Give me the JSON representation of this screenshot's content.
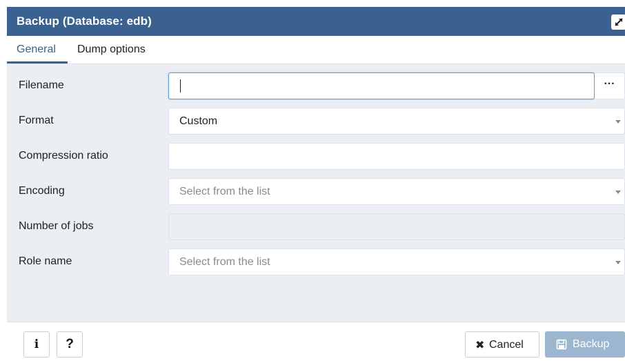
{
  "dialog": {
    "title": "Backup (Database: edb)"
  },
  "tabs": [
    {
      "label": "General",
      "active": true
    },
    {
      "label": "Dump options",
      "active": false
    }
  ],
  "fields": {
    "filename": {
      "label": "Filename",
      "value": "",
      "browse_label": "···"
    },
    "format": {
      "label": "Format",
      "value": "Custom"
    },
    "compression_ratio": {
      "label": "Compression ratio",
      "value": ""
    },
    "encoding": {
      "label": "Encoding",
      "placeholder": "Select from the list"
    },
    "number_of_jobs": {
      "label": "Number of jobs",
      "value": "",
      "disabled": true
    },
    "role_name": {
      "label": "Role name",
      "placeholder": "Select from the list"
    }
  },
  "footer": {
    "info_label": "i",
    "help_label": "?",
    "cancel_label": "Cancel",
    "backup_label": "Backup"
  },
  "colors": {
    "titlebar": "#3a6190",
    "accent": "#326690",
    "panel_bg": "#ebeef3",
    "backup_disabled": "#9cb6cf"
  },
  "icons": {
    "maximize": "expand-icon",
    "cancel": "times-icon",
    "backup": "save-icon"
  }
}
